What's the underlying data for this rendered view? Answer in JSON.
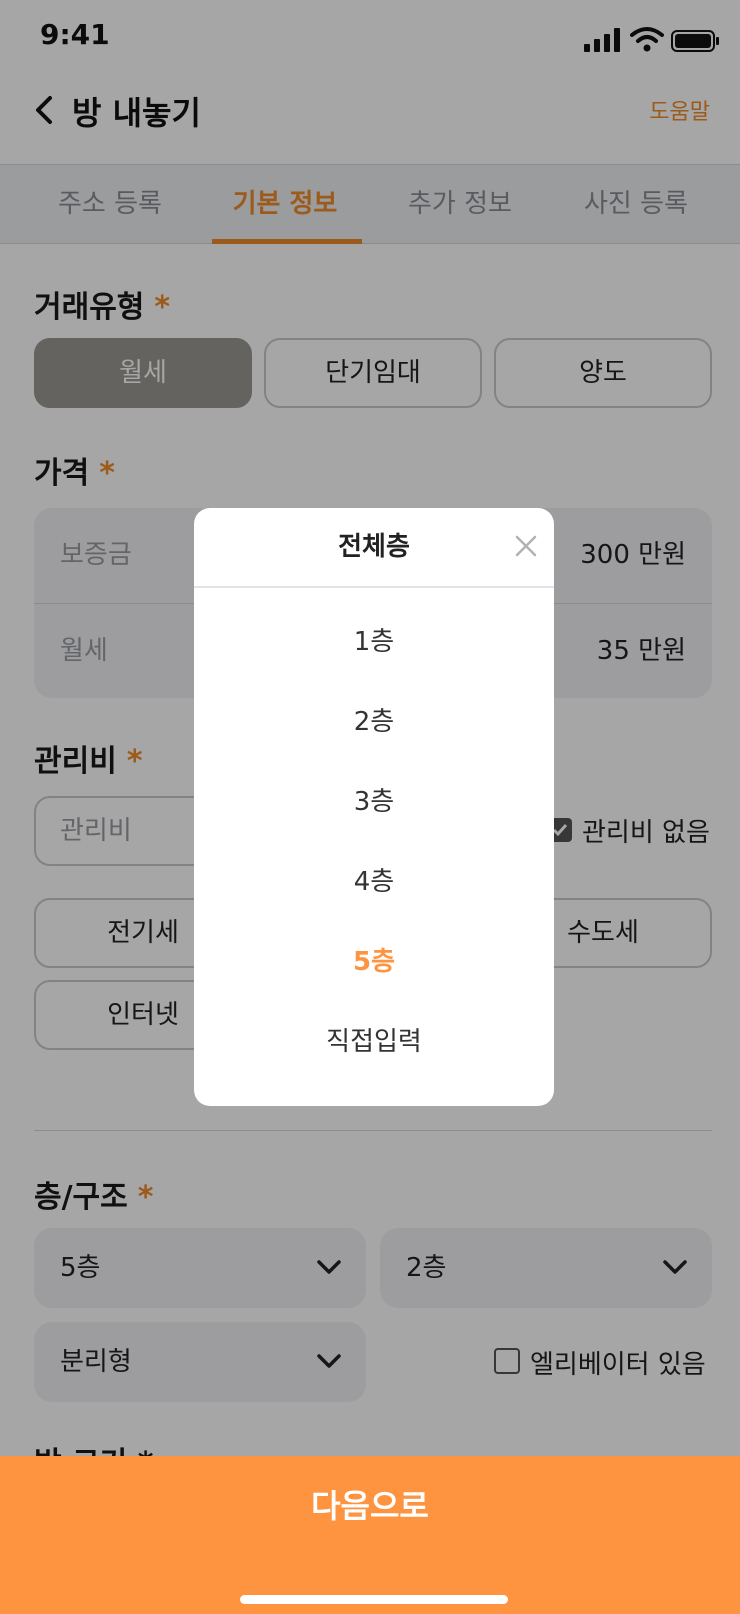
{
  "status": {
    "time": "9:41"
  },
  "header": {
    "title": "방 내놓기",
    "help": "도움말"
  },
  "tabs": [
    {
      "label": "주소 등록"
    },
    {
      "label": "기본 정보"
    },
    {
      "label": "추가 정보"
    },
    {
      "label": "사진 등록"
    }
  ],
  "active_tab": "기본 정보",
  "deal": {
    "title": "거래유형",
    "required_mark": "*",
    "options": [
      "월세",
      "단기임대",
      "양도"
    ],
    "selected": "월세"
  },
  "price": {
    "title": "가격",
    "required_mark": "*",
    "rows": [
      {
        "label": "보증금",
        "value": "300 만원"
      },
      {
        "label": "월세",
        "value": "35 만원"
      }
    ]
  },
  "fee": {
    "title": "관리비",
    "required_mark": "*",
    "placeholder": "관리비",
    "none_label": "관리비 없음",
    "none_checked": true,
    "items": [
      "전기세",
      "수도세",
      "인터넷"
    ]
  },
  "floor": {
    "title": "층/구조",
    "required_mark": "*",
    "total_floor": "5층",
    "floor": "2층",
    "structure": "분리형",
    "elevator_label": "엘리베이터 있음",
    "elevator_checked": false
  },
  "room_size_title_partial": "방 크기 *",
  "footer": {
    "next": "다음으로"
  },
  "modal": {
    "title": "전체층",
    "options": [
      "1층",
      "2층",
      "3층",
      "4층",
      "5층",
      "직접입력"
    ],
    "selected": "5층"
  },
  "colors": {
    "accent": "#ff9440",
    "accent_text": "#f08a2a",
    "selected_segment": "#9a9894"
  },
  "icons": [
    "back-icon",
    "signal-icon",
    "wifi-icon",
    "battery-icon",
    "chevron-down-icon",
    "close-icon",
    "checkbox-icon"
  ]
}
